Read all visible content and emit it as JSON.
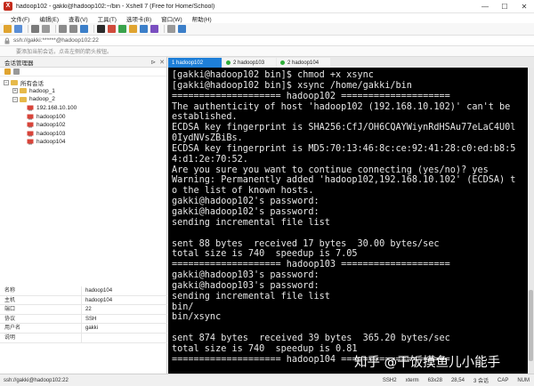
{
  "window": {
    "title": "hadoop102 - gakki@hadoop102:~/bin - Xshell 7 (Free for Home/School)",
    "minimize": "—",
    "maximize": "☐",
    "close": "✕"
  },
  "menu": [
    "文件(F)",
    "编辑(E)",
    "查看(V)",
    "工具(T)",
    "选项卡(B)",
    "窗口(W)",
    "帮助(H)"
  ],
  "address": {
    "value": "ssh://gakki:******@hadoop102:22"
  },
  "hint": "要添加当前会话，点击左侧的箭头按钮。",
  "session_manager": {
    "title": "会话管理器",
    "pin": "⊳",
    "close": "✕",
    "tree": {
      "root": "所有会话",
      "groups": [
        {
          "name": "hadoop_1",
          "collapsed": true
        },
        {
          "name": "hadoop_2",
          "collapsed": false,
          "hosts": [
            "192.168.10.100",
            "hadoop100",
            "hadoop102",
            "hadoop103",
            "hadoop104"
          ]
        }
      ]
    },
    "properties": [
      {
        "key": "名称",
        "value": "hadoop104"
      },
      {
        "key": "主机",
        "value": "hadoop104"
      },
      {
        "key": "端口",
        "value": "22"
      },
      {
        "key": "协议",
        "value": "SSH"
      },
      {
        "key": "用户名",
        "value": "gakki"
      },
      {
        "key": "说明",
        "value": ""
      }
    ]
  },
  "tabs": [
    {
      "label": "1 hadoop102",
      "active": true,
      "color": "#1e7fd8"
    },
    {
      "label": "2 hadoop103",
      "active": false,
      "color": "#2fae3a"
    },
    {
      "label": "2 hadoop104",
      "active": false,
      "color": "#2fae3a"
    }
  ],
  "terminal": {
    "lines": [
      "[gakki@hadoop102 bin]$ chmod +x xsync",
      "[gakki@hadoop102 bin]$ xsync /home/gakki/bin",
      "==================== hadoop102 ====================",
      "The authenticity of host 'hadoop102 (192.168.10.102)' can't be",
      "established.",
      "ECDSA key fingerprint is SHA256:CfJ/OH6CQAYWiynRdHSAu77eLaC4U0l",
      "0IydNVsZBiBs.",
      "ECDSA key fingerprint is MD5:70:13:46:8c:ce:92:41:28:c0:ed:b8:5",
      "4:d1:2e:70:52.",
      "Are you sure you want to continue connecting (yes/no)? yes",
      "Warning: Permanently added 'hadoop102,192.168.10.102' (ECDSA) t",
      "o the list of known hosts.",
      "gakki@hadoop102's password:",
      "gakki@hadoop102's password:",
      "sending incremental file list",
      "",
      "sent 88 bytes  received 17 bytes  30.00 bytes/sec",
      "total size is 740  speedup is 7.05",
      "==================== hadoop103 ====================",
      "gakki@hadoop103's password:",
      "gakki@hadoop103's password:",
      "sending incremental file list",
      "bin/",
      "bin/xsync",
      "",
      "sent 874 bytes  received 39 bytes  365.20 bytes/sec",
      "total size is 740  speedup is 0.81",
      "==================== hadoop104 ===================="
    ]
  },
  "watermark": "知乎 @干饭摸鱼儿小能手",
  "statusbar": {
    "address": "ssh://gakki@hadoop102:22",
    "protocol": "SSH2",
    "term": "xterm",
    "size": "63x28",
    "cursor": "28,54",
    "sessions": "3 会话",
    "caps": "CAP",
    "num": "NUM"
  }
}
